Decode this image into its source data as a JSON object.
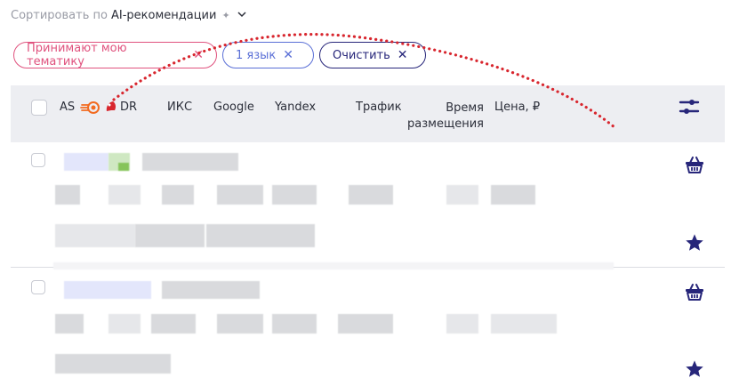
{
  "sort": {
    "label": "Сортировать по",
    "value": "AI-рекомендации",
    "sparkle": "✦",
    "chevron": "⌄"
  },
  "chips": [
    {
      "label": "Принимают мою тематику",
      "x": "✕"
    },
    {
      "label": "1 язык",
      "x": "✕"
    },
    {
      "label": "Очистить",
      "x": "✕"
    }
  ],
  "columns": {
    "as": "AS",
    "dr": "DR",
    "iks": "ИКС",
    "google": "Google",
    "yandex": "Yandex",
    "traffic": "Трафик",
    "time_line1": "Время",
    "time_line2": "размещения",
    "price": "Цена, ₽"
  },
  "icons": {
    "as_logo": "semrush-icon",
    "dr_logo": "ahrefs-icon",
    "filter": "sliders-icon",
    "basket": "basket-icon",
    "star": "star-icon"
  },
  "colors": {
    "accent_navy": "#27267a",
    "chip_pink": "#e0527e",
    "chip_blue": "#5a6fd6",
    "annotation_red": "#d8262e",
    "semrush_orange": "#f26b21",
    "header_bg": "#edeef2"
  }
}
